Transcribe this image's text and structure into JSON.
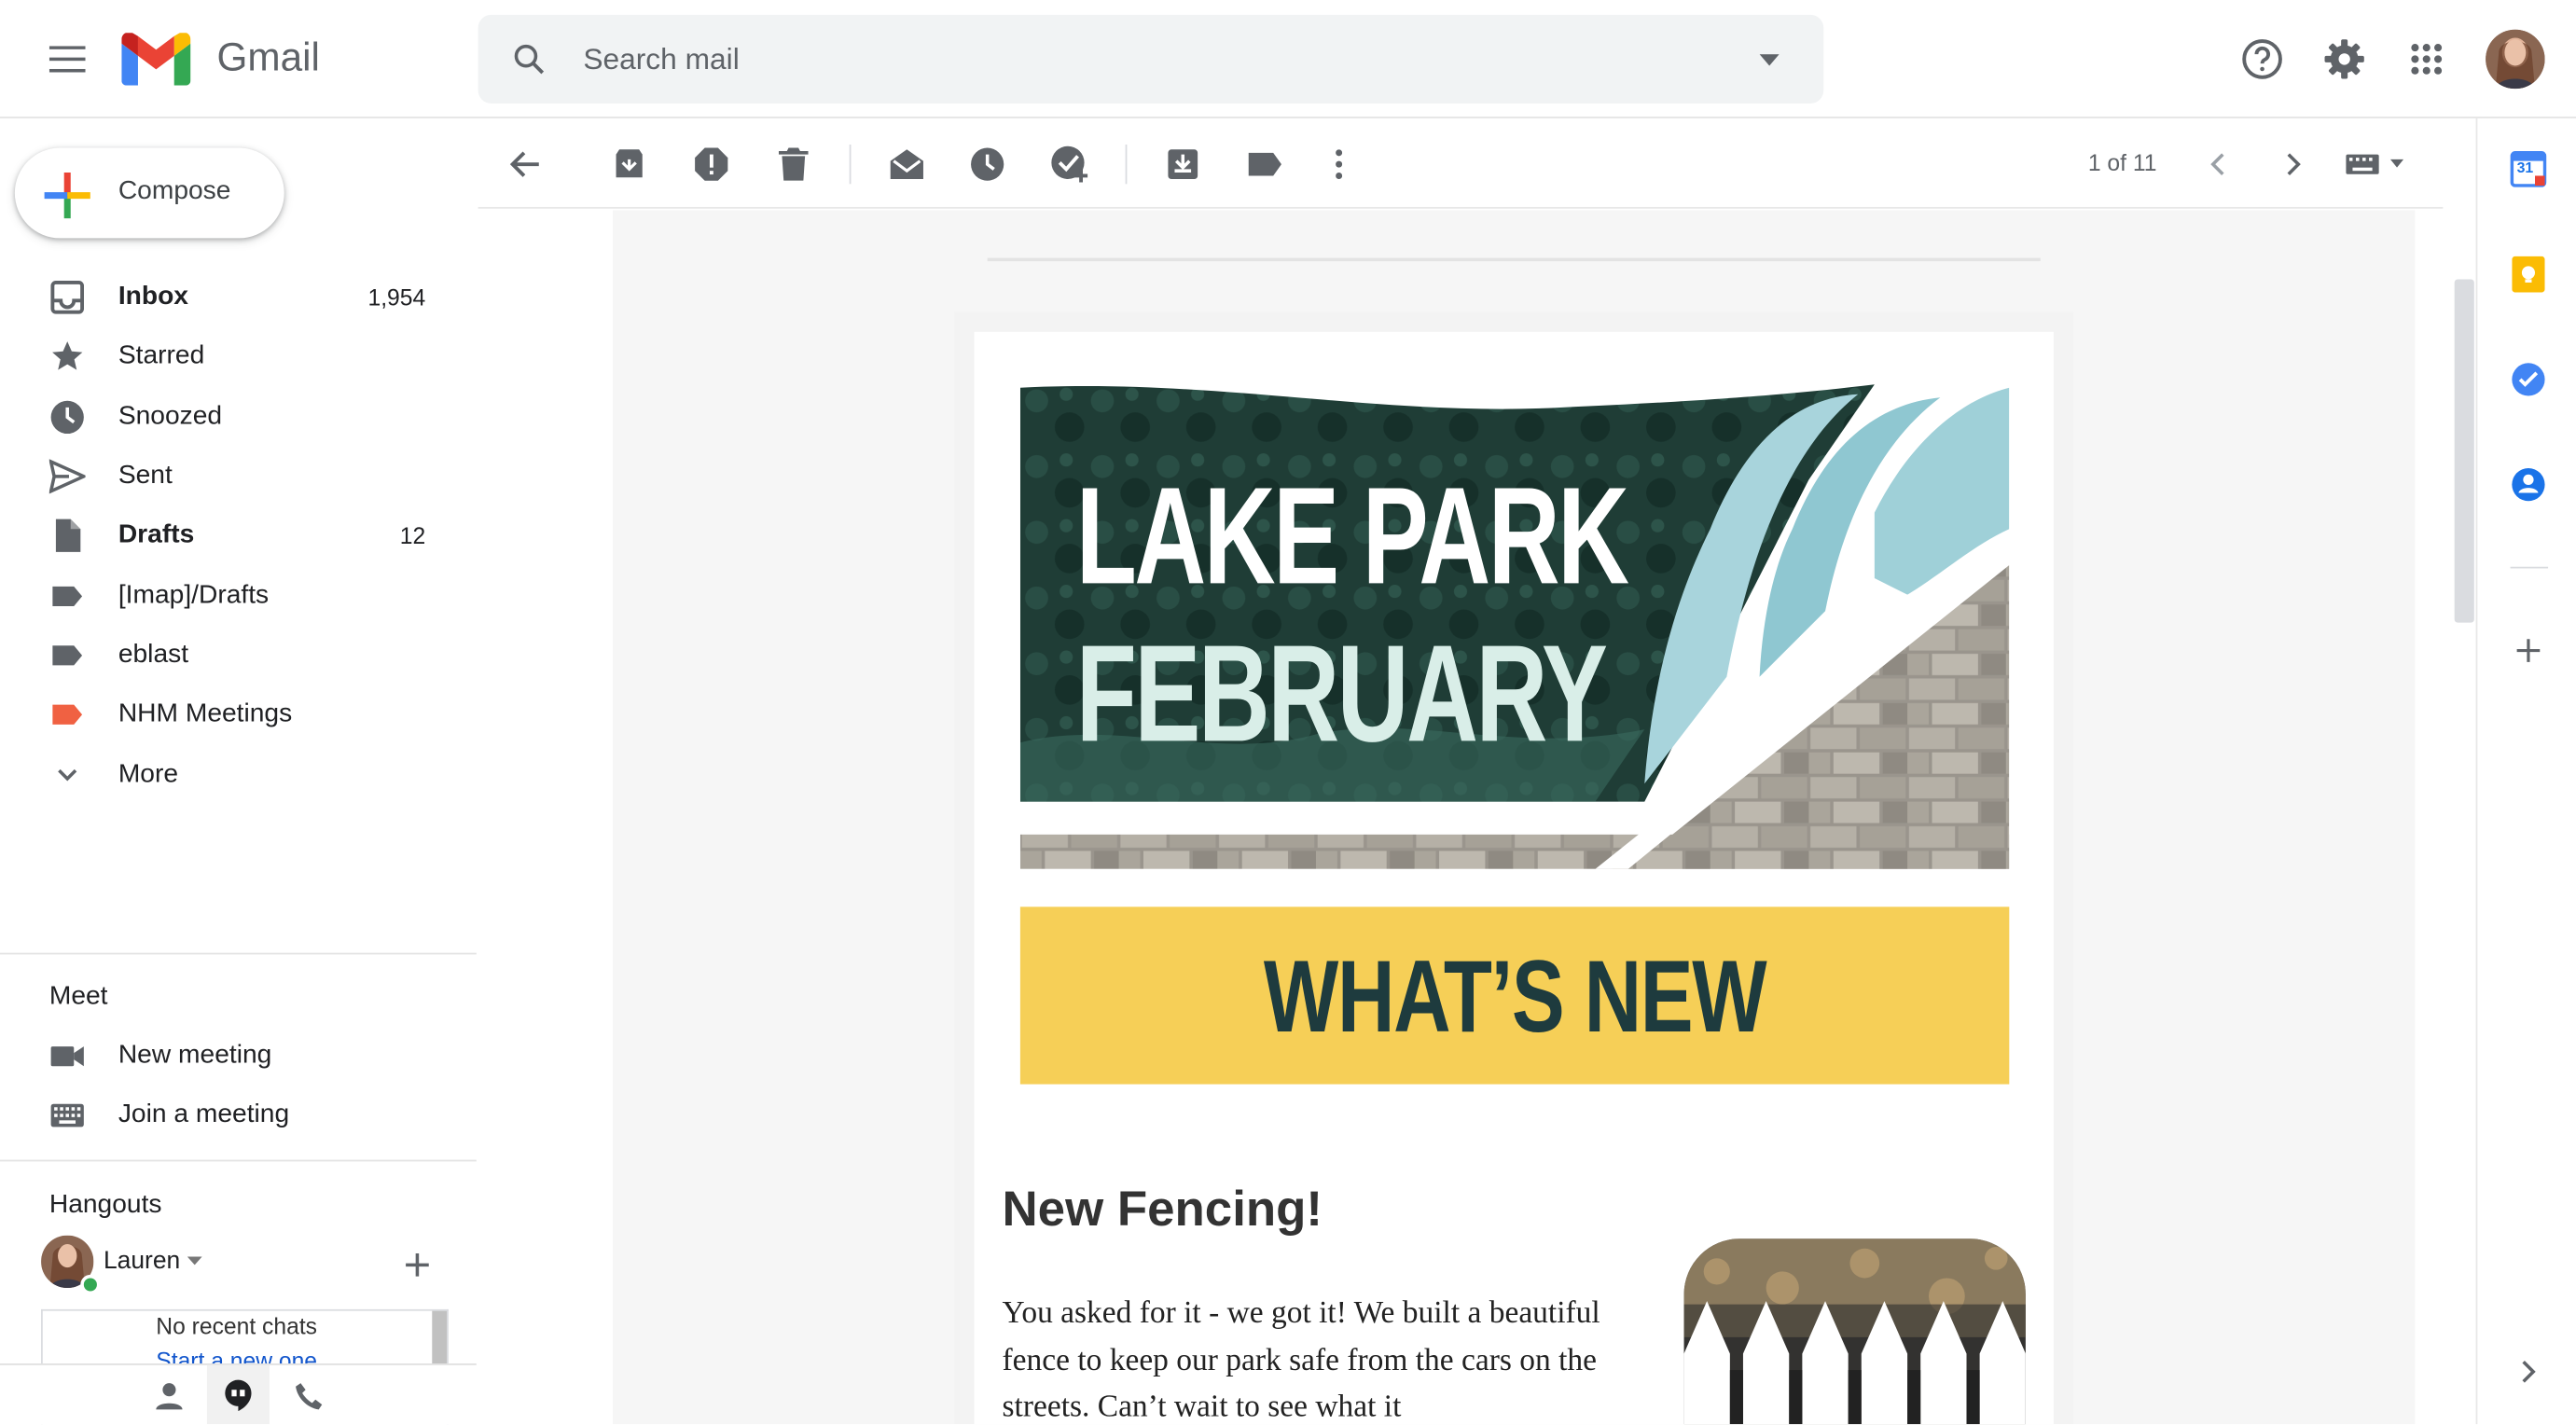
{
  "app": {
    "brand": "Gmail"
  },
  "search": {
    "placeholder": "Search mail"
  },
  "compose": {
    "label": "Compose"
  },
  "sidebar": {
    "items": [
      {
        "label": "Inbox",
        "count": "1,954",
        "icon": "inbox-icon",
        "bold": true
      },
      {
        "label": "Starred",
        "count": "",
        "icon": "star-icon",
        "bold": false
      },
      {
        "label": "Snoozed",
        "count": "",
        "icon": "clock-icon",
        "bold": false
      },
      {
        "label": "Sent",
        "count": "",
        "icon": "send-icon",
        "bold": false
      },
      {
        "label": "Drafts",
        "count": "12",
        "icon": "draft-icon",
        "bold": true
      },
      {
        "label": "[Imap]/Drafts",
        "count": "",
        "icon": "label-icon",
        "bold": false
      },
      {
        "label": "eblast",
        "count": "",
        "icon": "label-icon",
        "bold": false
      },
      {
        "label": "NHM Meetings",
        "count": "",
        "icon": "label-icon",
        "bold": false
      },
      {
        "label": "More",
        "count": "",
        "icon": "chevron-down-icon",
        "bold": false
      }
    ]
  },
  "meet": {
    "title": "Meet",
    "new_meeting": "New meeting",
    "join_meeting": "Join a meeting"
  },
  "hangouts": {
    "title": "Hangouts",
    "user": "Lauren",
    "no_chats": "No recent chats",
    "start_new": "Start a new one"
  },
  "toolbar": {
    "pagination": "1 of 11"
  },
  "email": {
    "hero_line1": "LAKE PARK",
    "hero_line2": "FEBRUARY",
    "banner": "WHAT’S NEW",
    "heading": "New Fencing!",
    "body": "You asked for it - we got it! We built a beautiful fence to keep our park safe from the cars on the streets. Can’t wait to see what it"
  },
  "rail": {
    "calendar_day": "31"
  },
  "colors": {
    "accent_red": "#ea4335",
    "banner_yellow": "#f6cf57",
    "hero_green": "#1f3d36",
    "label_red": "#f06142"
  }
}
